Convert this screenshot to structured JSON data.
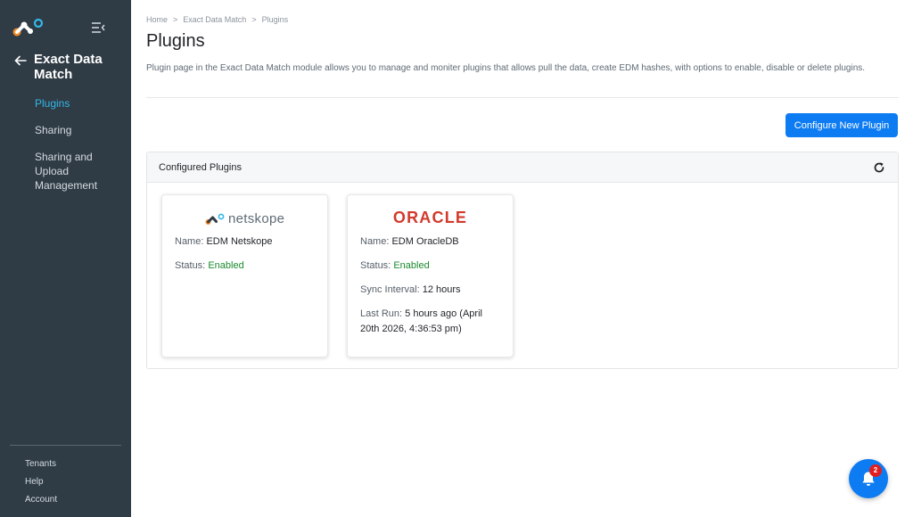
{
  "sidebar": {
    "module_title": "Exact Data Match",
    "nav": [
      {
        "label": "Plugins",
        "active": true
      },
      {
        "label": "Sharing",
        "active": false
      },
      {
        "label": "Sharing and Upload Management",
        "active": false
      }
    ],
    "bottom": [
      {
        "label": "Tenants"
      },
      {
        "label": "Help"
      },
      {
        "label": "Account"
      }
    ]
  },
  "breadcrumb": [
    "Home",
    "Exact Data Match",
    "Plugins"
  ],
  "page": {
    "title": "Plugins",
    "description": "Plugin page in the Exact Data Match module allows you to manage and moniter plugins that allows pull the data, create EDM hashes, with options to enable, disable or delete plugins.",
    "configure_button": "Configure New Plugin"
  },
  "panel": {
    "title": "Configured Plugins",
    "refresh_icon": "refresh-icon"
  },
  "cards": [
    {
      "logo_text": "netskope",
      "name_label": "Name:",
      "name": "EDM Netskope",
      "status_label": "Status:",
      "status": "Enabled"
    },
    {
      "logo_text": "ORACLE",
      "name_label": "Name:",
      "name": "EDM OracleDB",
      "status_label": "Status:",
      "status": "Enabled",
      "sync_label": "Sync Interval:",
      "sync": "12 hours",
      "last_run_label": "Last Run:",
      "last_run": "5 hours ago (April 20th 2026, 4:36:53 pm)"
    }
  ],
  "notifications": {
    "count": "2"
  },
  "colors": {
    "sidebar_bg": "#2f3b45",
    "accent": "#0d7cf2",
    "active_nav": "#34b8e8",
    "enabled_green": "#1b8a2e",
    "oracle_red": "#d23a2c",
    "badge_red": "#e02020"
  }
}
